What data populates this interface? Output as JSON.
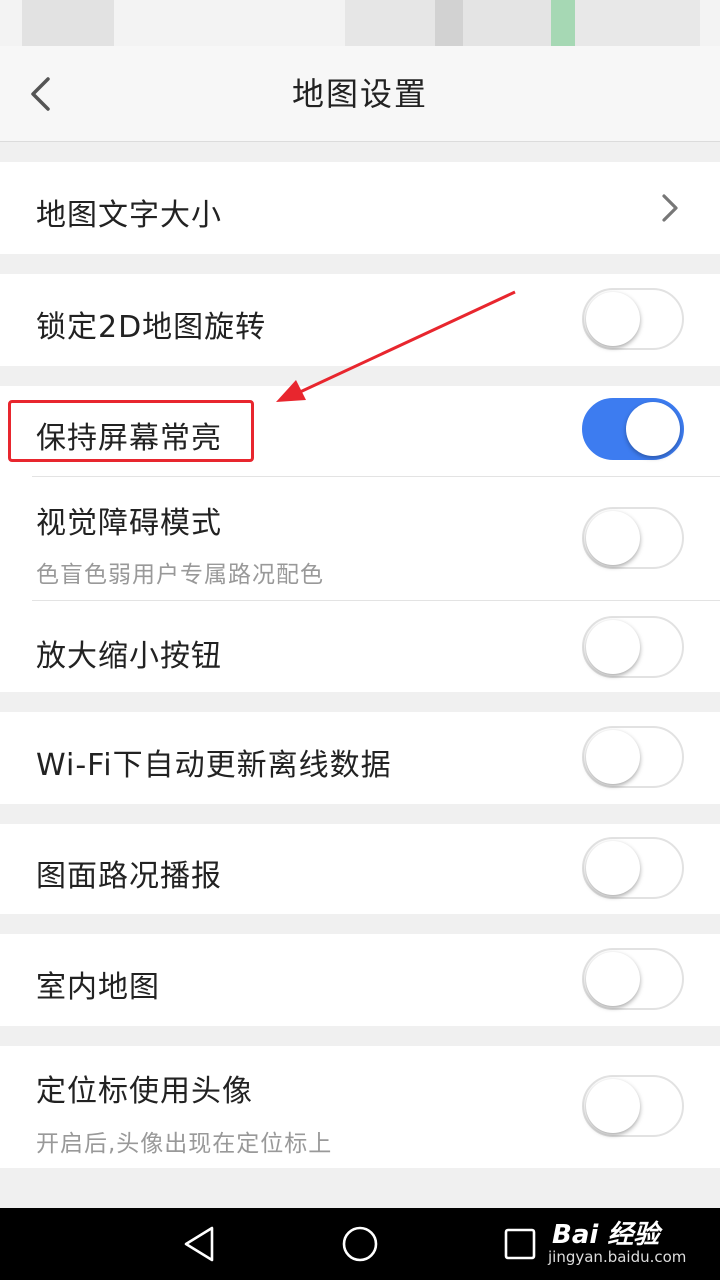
{
  "header": {
    "title": "地图设置"
  },
  "settings": {
    "map_text_size": {
      "label": "地图文字大小"
    },
    "lock_2d_rotation": {
      "label": "锁定2D地图旋转",
      "enabled": false
    },
    "keep_screen_on": {
      "label": "保持屏幕常亮",
      "enabled": true
    },
    "visual_impairment_mode": {
      "label": "视觉障碍模式",
      "subtitle": "色盲色弱用户专属路况配色",
      "enabled": false
    },
    "zoom_buttons": {
      "label": "放大缩小按钮",
      "enabled": false
    },
    "wifi_auto_update": {
      "label": "Wi-Fi下自动更新离线数据",
      "enabled": false
    },
    "traffic_broadcast": {
      "label": "图面路况播报",
      "enabled": false
    },
    "indoor_map": {
      "label": "室内地图",
      "enabled": false
    },
    "avatar_location_marker": {
      "label": "定位标使用头像",
      "subtitle": "开启后,头像出现在定位标上",
      "enabled": false
    }
  },
  "watermark": {
    "brand": "Bai 经验",
    "url": "jingyan.baidu.com"
  },
  "colors": {
    "toggle_on": "#3d7cf0",
    "annotation_red": "#e8262e"
  }
}
